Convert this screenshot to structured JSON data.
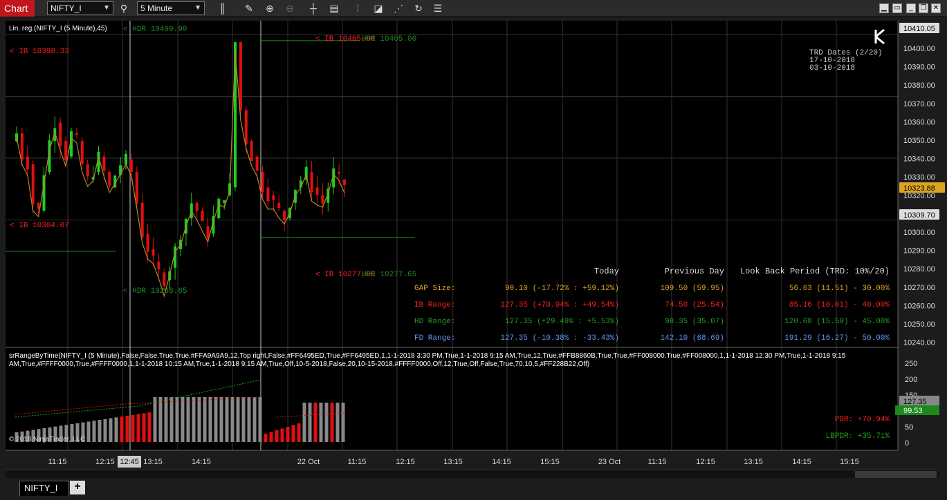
{
  "toolbar": {
    "app_label": "Chart",
    "instrument": "NIFTY_I",
    "interval": "5 Minute"
  },
  "chart": {
    "indicator_title": "Lin. reg.(NIFTY_I (5 Minute),45)",
    "copyright": "© 2018 NinjaTrader, LLC",
    "indicator_params": "srRangeByTime(NIFTY_I (5 Minute),False,False,True,True,#FFA9A9A9,12,Top right,False,#FF6495ED,True,#FF6495ED,1,1-1-2018 3:30 PM,True,1-1-2018 9:15 AM,True,12,True,#FFB8860B,True,True,#FF008000,True,#FF008000,1,1-1-2018 12:30 PM,True,1-1-2018 9:15 AM,True,#FFFF0000,True,#FFFF0000,1,1-1-2018 10:15 AM,True,1-1-2018 9:15 AM,True,Off,10-5-2018,False,20,10-15-2018,#FFFF0000,Off,12,True,Off,False,True,70,10,5,#FF228B22,Off)"
  },
  "price_axis": {
    "labels": [
      "10400.00",
      "10390.00",
      "10380.00",
      "10370.00",
      "10360.00",
      "10350.00",
      "10340.00",
      "10330.00",
      "10320.00",
      "10310.00",
      "10300.00",
      "10290.00",
      "10280.00",
      "10270.00",
      "10260.00",
      "10250.00",
      "10240.00"
    ],
    "top_tag": "10410.05",
    "last_price": "10323.88",
    "tag_309": "10309.70"
  },
  "lower_axis": {
    "labels": [
      "250",
      "200",
      "150",
      "100",
      "50",
      "0"
    ],
    "tag_a": "127.35",
    "tag_b": "99.53"
  },
  "time_axis": {
    "labels": [
      "11:15",
      "12:15",
      "13:15",
      "14:15",
      "22 Oct",
      "11:15",
      "12:15",
      "13:15",
      "14:15",
      "15:15",
      "23 Oct",
      "11:15",
      "12:15",
      "13:15",
      "14:15",
      "15:15"
    ],
    "cursor_label": "12:45"
  },
  "levels": {
    "hdr_top": "< HDR 10409.90",
    "ib_top_left": "< IB 10398.33",
    "ib_top_right": "< IB 10405.00",
    "hdr_top_right": "HDR 10405.00",
    "ib_mid": "< IB 10304.07",
    "hdr_low": "< HDR 10268.65",
    "ib_low_right": "< IB 10277.65",
    "hdr_low_right": "HDR 10277.65"
  },
  "trd_box": {
    "title": "TRD Dates (2/20)",
    "d1": "17-10-2018",
    "d2": "03-10-2018"
  },
  "stats": {
    "head_today": "Today",
    "head_prev": "Previous Day",
    "head_lookback": "Look Back Period (TRD: 10%/20)",
    "rows": [
      {
        "label": "GAP Size:",
        "today": "90.10 (-17.72% : +59.12%)",
        "prev": "109.50 (59.95)",
        "lookback": "56.63 (11.51) - 30.00%",
        "color": "#DAA520"
      },
      {
        "label": "IB Range:",
        "today": "127.35 (+70.94% : +49.54%)",
        "prev": "74.50 (25.54)",
        "lookback": "85.16 (10.01) - 40.00%",
        "color": "#FF2020"
      },
      {
        "label": "HD Range:",
        "today": "127.35 (+29.49% : +5.53%)",
        "prev": "98.35 (35.07)",
        "lookback": "120.68 (15.59) - 45.00%",
        "color": "#22A022"
      },
      {
        "label": "FD Range:",
        "today": "127.35 (-10.38% : -33.43%)",
        "prev": "142.10 (68.69)",
        "lookback": "191.29 (16.27) - 50.00%",
        "color": "#6495ED"
      }
    ]
  },
  "lower_labels": {
    "pdr": "PDR: +70.94%",
    "lbpdr": "LBPDR: +35.71%"
  },
  "tabs": {
    "active": "NIFTY_I",
    "add": "+"
  },
  "colors": {
    "up": "#22cc22",
    "down": "#e01010",
    "regression": "#b8862b",
    "ib": "#ff2020",
    "hdr": "#228b22"
  }
}
